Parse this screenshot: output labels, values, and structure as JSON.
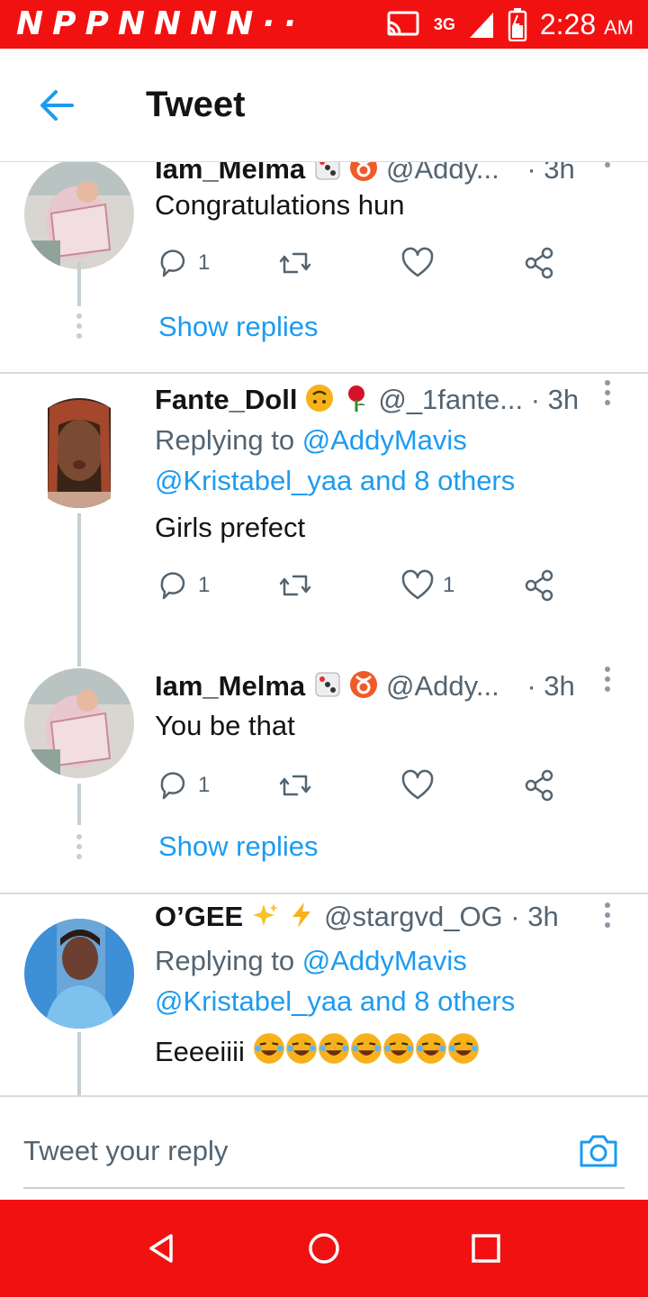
{
  "status_bar": {
    "left_icons": "NPPNNNN··",
    "network": "3G",
    "time": "2:28",
    "ampm": "AM"
  },
  "header": {
    "title": "Tweet"
  },
  "tweets": [
    {
      "name": "Iam_Melma",
      "handle": "@Addy...",
      "time": "· 3h",
      "text": "Congratulations hun",
      "reply_count": "1",
      "like_count": "",
      "show_replies": "Show replies"
    },
    {
      "name": "Fante_Doll",
      "handle": "@_1fante...",
      "time": "· 3h",
      "replying_prefix": "Replying to",
      "replying_user": "@AddyMavis",
      "replying_rest": "@Kristabel_yaa and 8 others",
      "text": "Girls prefect",
      "reply_count": "1",
      "like_count": "1"
    },
    {
      "name": "Iam_Melma",
      "handle": "@Addy...",
      "time": "· 3h",
      "text": "You be that",
      "reply_count": "1",
      "like_count": "",
      "show_replies": "Show replies"
    },
    {
      "name": "O’GEE",
      "handle": "@stargvd_OG",
      "time": "· 3h",
      "replying_prefix": "Replying to",
      "replying_user": "@AddyMavis",
      "replying_rest": "@Kristabel_yaa and 8 others",
      "text": "Eeeeiiii",
      "text_emoji": "😂😂😂😂😂😂😂"
    }
  ],
  "reply_bar": {
    "placeholder": "Tweet your reply"
  },
  "colors": {
    "accent": "#1d9bf0",
    "status_bar": "#f21111",
    "secondary_text": "#536471"
  },
  "icons": [
    "back-arrow-icon",
    "reply-icon",
    "retweet-icon",
    "like-icon",
    "share-icon",
    "more-icon",
    "camera-icon",
    "nav-back-icon",
    "nav-home-icon",
    "nav-recents-icon"
  ]
}
